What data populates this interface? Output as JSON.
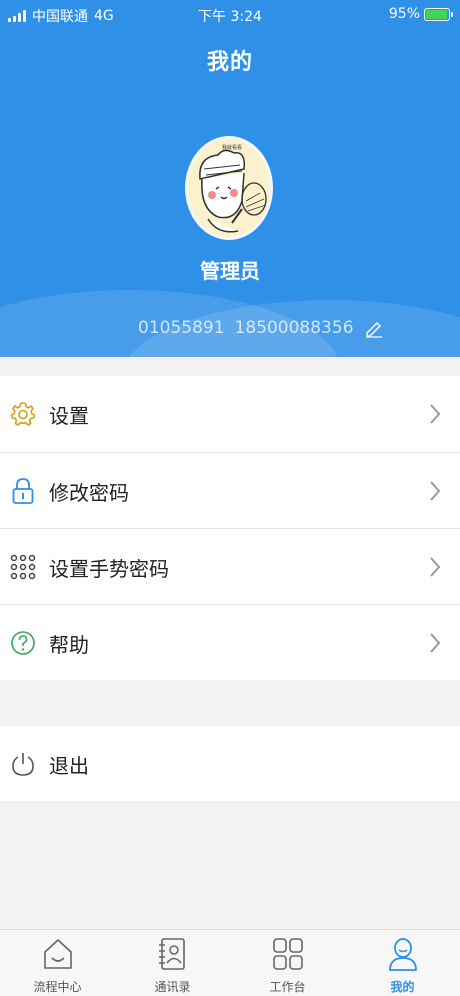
{
  "status_bar": {
    "carrier": "中国联通",
    "network": "4G",
    "time": "下午 3:24",
    "battery": "95%",
    "battery_level": 0.95
  },
  "header": {
    "title": "我的",
    "username": "管理员",
    "user_id": "01055891",
    "phone": "18500088356"
  },
  "menu": [
    {
      "label": "设置",
      "icon": "gear-icon"
    },
    {
      "label": "修改密码",
      "icon": "lock-icon"
    },
    {
      "label": "设置手势密码",
      "icon": "gesture-grid-icon"
    },
    {
      "label": "帮助",
      "icon": "help-icon"
    }
  ],
  "logout": {
    "label": "退出",
    "icon": "power-icon"
  },
  "tabbar": [
    {
      "label": "流程中心",
      "icon": "home-icon"
    },
    {
      "label": "通讯录",
      "icon": "contacts-icon"
    },
    {
      "label": "工作台",
      "icon": "grid-icon"
    },
    {
      "label": "我的",
      "icon": "user-icon",
      "active": true
    }
  ],
  "colors": {
    "primary": "#2f90e8",
    "settings_icon": "#d4a017",
    "lock_icon": "#2f90e8",
    "help_icon": "#34a853",
    "battery_fill": "#3dd65a"
  }
}
